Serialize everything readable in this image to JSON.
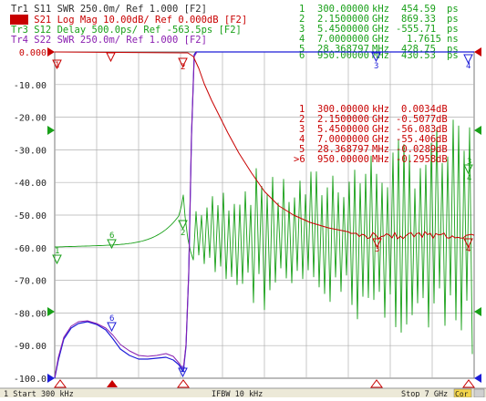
{
  "traces": [
    {
      "id": "Tr1",
      "text": "Tr1  S11  SWR 250.0m/ Ref 1.000 [F2]",
      "color": "#2e2e2e",
      "active": false
    },
    {
      "id": "Tr2",
      "text": "Tr2  S21  Log Mag 10.00dB/ Ref 0.000dB [F2]",
      "color": "#c80000",
      "active": true
    },
    {
      "id": "Tr3",
      "text": "Tr3  S12  Delay 500.0ps/ Ref -563.5ps [F2]",
      "color": "#19a019",
      "active": false
    },
    {
      "id": "Tr4",
      "text": "Tr4  S22  SWR 250.0m/ Ref 1.000 [F2]",
      "color": "#8a1fb0",
      "active": false
    }
  ],
  "marker_table_top": {
    "color": "#19a019",
    "rows": [
      [
        "1",
        "300.00000",
        "kHz",
        "454.59",
        "ps"
      ],
      [
        "2",
        "2.1500000",
        "GHz",
        "869.33",
        "ps"
      ],
      [
        "3",
        "5.4500000",
        "GHz",
        "-555.71",
        "ps"
      ],
      [
        "4",
        "7.0000000",
        "GHz",
        "1.7615",
        "ns"
      ],
      [
        "5",
        "28.368797",
        "MHz",
        "428.75",
        "ps"
      ],
      [
        "6",
        "950.00000",
        "MHz",
        "430.53",
        "ps"
      ]
    ]
  },
  "marker_table_mid": {
    "color": "#c80000",
    "rows": [
      [
        "1",
        "300.00000",
        "kHz",
        "0.0034",
        "dB"
      ],
      [
        "2",
        "2.1500000",
        "GHz",
        "-0.5077",
        "dB"
      ],
      [
        "3",
        "5.4500000",
        "GHz",
        "-56.083",
        "dB"
      ],
      [
        "4",
        "7.0000000",
        "GHz",
        "-55.406",
        "dB"
      ],
      [
        "5",
        "28.368797",
        "MHz",
        "-0.0289",
        "dB"
      ],
      [
        ">6",
        "950.00000",
        "MHz",
        "-0.2958",
        "dB"
      ]
    ]
  },
  "y_axis_labels": [
    "0.000",
    "-10.00",
    "-20.00",
    "-30.00",
    "-40.00",
    "-50.00",
    "-60.00",
    "-70.00",
    "-80.00",
    "-90.00",
    "-100.0"
  ],
  "footer": {
    "start": "1  Start 300 kHz",
    "ifbw": "IFBW 10 kHz",
    "stop": "Stop 7 GHz",
    "badge": "Cor"
  },
  "colors": {
    "s11": "#1c1cd8",
    "s21": "#c80000",
    "s12": "#19a019",
    "s22": "#8a1fb0",
    "grid": "#b0b0b0"
  }
}
